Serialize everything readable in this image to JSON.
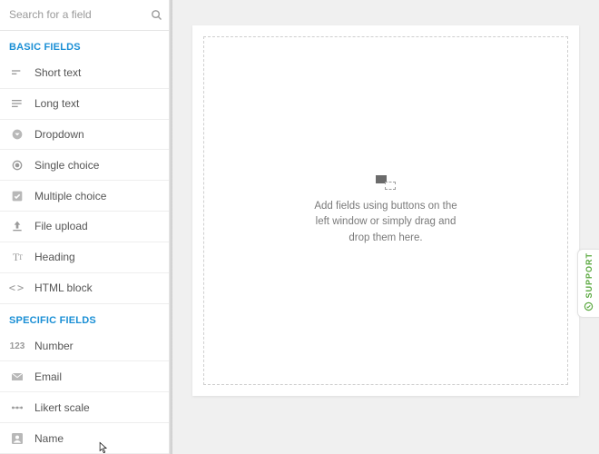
{
  "search": {
    "placeholder": "Search for a field"
  },
  "sections": {
    "basic": {
      "label": "BASIC FIELDS",
      "items": [
        {
          "key": "short-text",
          "label": "Short text",
          "icon": "short-text-icon"
        },
        {
          "key": "long-text",
          "label": "Long text",
          "icon": "long-text-icon"
        },
        {
          "key": "dropdown",
          "label": "Dropdown",
          "icon": "dropdown-icon"
        },
        {
          "key": "single-choice",
          "label": "Single choice",
          "icon": "radio-icon"
        },
        {
          "key": "multiple-choice",
          "label": "Multiple choice",
          "icon": "checkbox-icon"
        },
        {
          "key": "file-upload",
          "label": "File upload",
          "icon": "upload-icon"
        },
        {
          "key": "heading",
          "label": "Heading",
          "icon": "heading-icon"
        },
        {
          "key": "html-block",
          "label": "HTML block",
          "icon": "code-icon"
        }
      ]
    },
    "specific": {
      "label": "SPECIFIC FIELDS",
      "items": [
        {
          "key": "number",
          "label": "Number",
          "icon": "number-icon"
        },
        {
          "key": "email",
          "label": "Email",
          "icon": "email-icon"
        },
        {
          "key": "likert-scale",
          "label": "Likert scale",
          "icon": "likert-icon"
        },
        {
          "key": "name",
          "label": "Name",
          "icon": "name-icon"
        }
      ]
    }
  },
  "dropzone": {
    "text": "Add fields using buttons on the left window or simply drag and drop them here."
  },
  "support": {
    "label": "SUPPORT"
  }
}
